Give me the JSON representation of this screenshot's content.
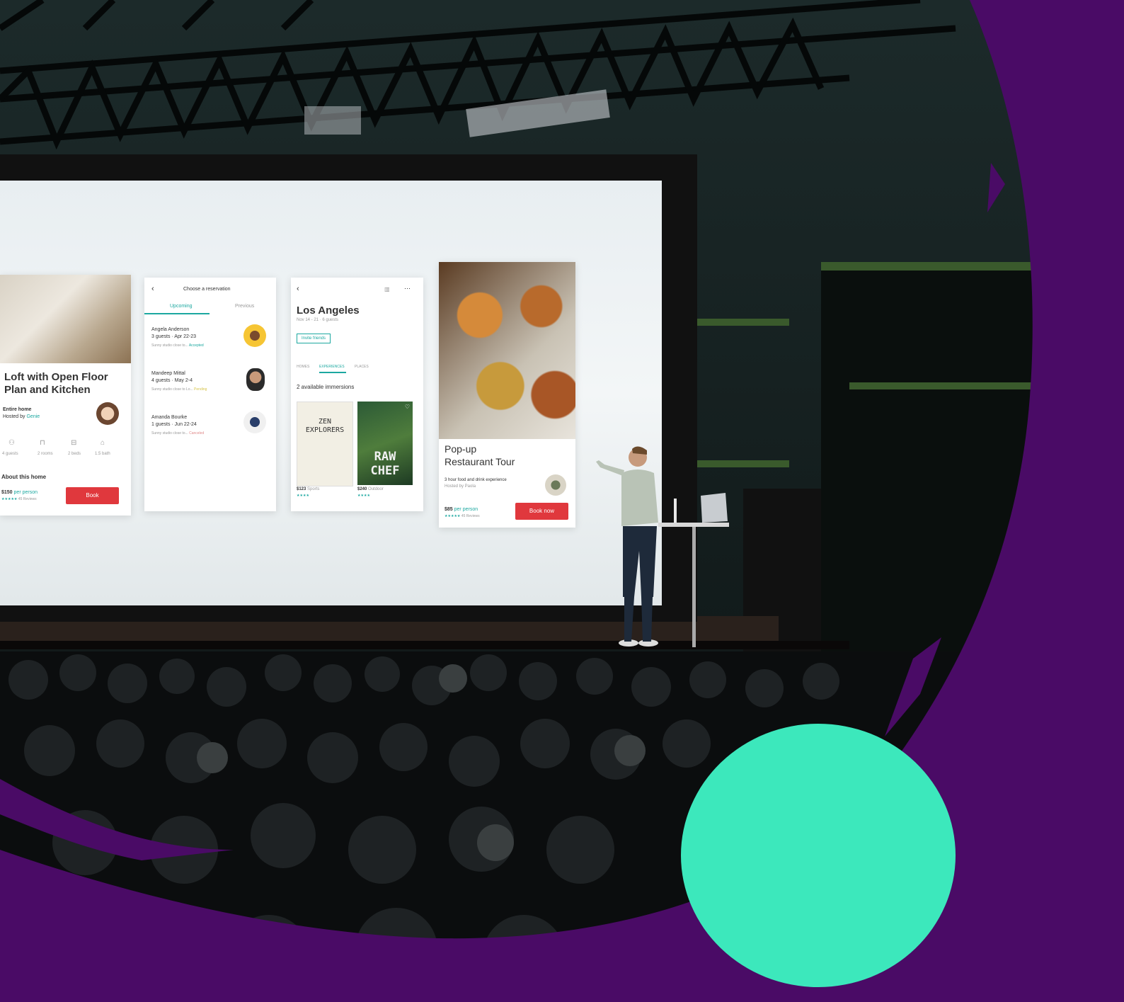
{
  "colors": {
    "purple": "#4a0b66",
    "mint": "#3ce8bc",
    "accent_red": "#e0383d",
    "teal": "#1ca8a0"
  },
  "card1": {
    "title_line1": "Loft with Open Floor",
    "title_line2": "Plan and Kitchen",
    "type": "Entire home",
    "hosted_prefix": "Hosted by",
    "host": "Genie",
    "amenities": [
      "4 guests",
      "2 rooms",
      "2 beds",
      "1.5 bath"
    ],
    "about": "About this home",
    "price": "$150",
    "price_suffix": "per person",
    "reviews": "45 Reviews",
    "button": "Book"
  },
  "card2": {
    "header": "Choose a reservation",
    "tab_active": "Upcoming",
    "tab_other": "Previous",
    "items": [
      {
        "name": "Angela Anderson",
        "meta": "3 guests · Apr 22-23",
        "desc": "Sunny studio close to...",
        "status": "Accepted"
      },
      {
        "name": "Mandeep Mittal",
        "meta": "4 guests · May 2-4",
        "desc": "Sunny studio close to Lo...",
        "status": "Pending"
      },
      {
        "name": "Amanda Bourke",
        "meta": "1 guests · Jun 22-24",
        "desc": "Sunny studio close to...",
        "status": "Canceled"
      }
    ]
  },
  "card3": {
    "title": "Los Angeles",
    "subtitle": "Nov 14 - 21 · 6 guests",
    "invite": "Invite friends",
    "tabs": [
      "HOMES",
      "EXPERIENCES",
      "PLACES"
    ],
    "section": "2 available immersions",
    "book1_title": "ZEN EXPLORERS",
    "book2_title": "RAW CHEF",
    "item1_price": "$123",
    "item1_cat": "Sports",
    "item2_price": "$240",
    "item2_cat": "Outdoor"
  },
  "card4": {
    "title_line1": "Pop-up",
    "title_line2": "Restaurant Tour",
    "desc": "3 hour food and drink experience",
    "hosted": "Hosted by Paola",
    "price": "$85",
    "price_suffix": "per person",
    "reviews": "45 Reviews",
    "button": "Book now"
  }
}
